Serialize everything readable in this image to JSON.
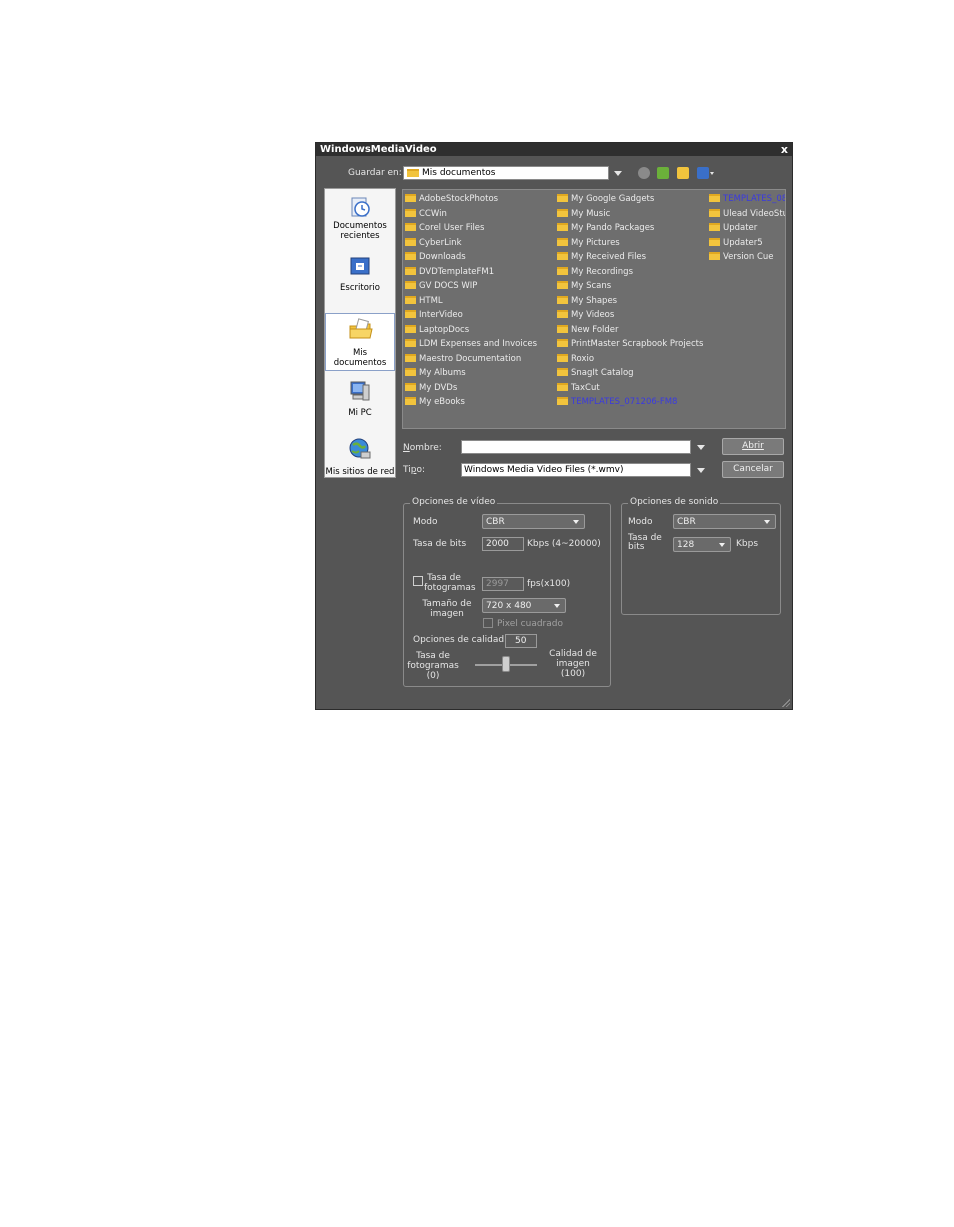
{
  "window": {
    "title": "WindowsMediaVideo",
    "close": "x"
  },
  "toolbar": {
    "save_in_label": "Guardar en:",
    "location": "Mis documentos",
    "icons": [
      "back-icon",
      "up-folder-icon",
      "new-folder-icon",
      "view-menu-icon"
    ]
  },
  "places": [
    {
      "label": "Documentos recientes",
      "icon": "recent-documents-icon"
    },
    {
      "label": "Escritorio",
      "icon": "desktop-icon"
    },
    {
      "label": "Mis documentos",
      "icon": "my-documents-icon",
      "selected": true
    },
    {
      "label": "Mi PC",
      "icon": "my-computer-icon"
    },
    {
      "label": "Mis sitios de red",
      "icon": "network-places-icon"
    }
  ],
  "files": {
    "col1": [
      "AdobeStockPhotos",
      "CCWin",
      "Corel User Files",
      "CyberLink",
      "Downloads",
      "DVDTemplateFM1",
      "GV DOCS WIP",
      "HTML",
      "InterVideo",
      "LaptopDocs",
      "LDM Expenses and Invoices",
      "Maestro Documentation",
      "My Albums",
      "My DVDs",
      "My eBooks"
    ],
    "col2": [
      "My Google Gadgets",
      "My Music",
      "My Pando Packages",
      "My Pictures",
      "My Received Files",
      "My Recordings",
      "My Scans",
      "My Shapes",
      "My Videos",
      "New Folder",
      "PrintMaster Scrapbook Projects",
      "Roxio",
      "SnagIt Catalog",
      "TaxCut",
      "TEMPLATES_071206-FM8"
    ],
    "col3": [
      "TEMPLATES_08",
      "Ulead VideoStu",
      "Updater",
      "Updater5",
      "Version Cue"
    ],
    "highlighted": [
      "TEMPLATES_071206-FM8",
      "TEMPLATES_08"
    ]
  },
  "filename": {
    "label": "Nombre:",
    "value": ""
  },
  "filetype": {
    "label": "Tipo:",
    "value": "Windows Media Video Files (*.wmv)"
  },
  "buttons": {
    "save": "Abrir",
    "cancel": "Cancelar"
  },
  "video_options": {
    "title": "Opciones de vídeo",
    "mode_label": "Modo",
    "mode_value": "CBR",
    "bitrate_label": "Tasa de bits",
    "bitrate_value": "2000",
    "bitrate_unit": "Kbps (4~20000)",
    "framerate_label_1": "Tasa de",
    "framerate_label_2": "fotogramas",
    "framerate_value": "2997",
    "framerate_unit": "fps(x100)",
    "framesize_label_1": "Tamaño de",
    "framesize_label_2": "imagen",
    "framesize_value": "720 x 480",
    "square_pixel_label": "Pixel cuadrado",
    "quality_label": "Opciones de calidad",
    "quality_value": "50",
    "slider_left_1": "Tasa de",
    "slider_left_2": "fotogramas",
    "slider_left_3": "(0)",
    "slider_right_1": "Calidad de",
    "slider_right_2": "imagen",
    "slider_right_3": "(100)",
    "slider_level": 0.5
  },
  "audio_options": {
    "title": "Opciones de sonido",
    "mode_label": "Modo",
    "mode_value": "CBR",
    "bitrate_label_1": "Tasa de",
    "bitrate_label_2": "bits",
    "bitrate_value": "128",
    "bitrate_unit": "Kbps"
  },
  "colors": {
    "dialog_bg": "#555555",
    "list_bg": "#6e6e6e",
    "titlebar": "#2f2f2f",
    "highlight_text": "#3a3ae0",
    "folder": "#f2c43d"
  }
}
